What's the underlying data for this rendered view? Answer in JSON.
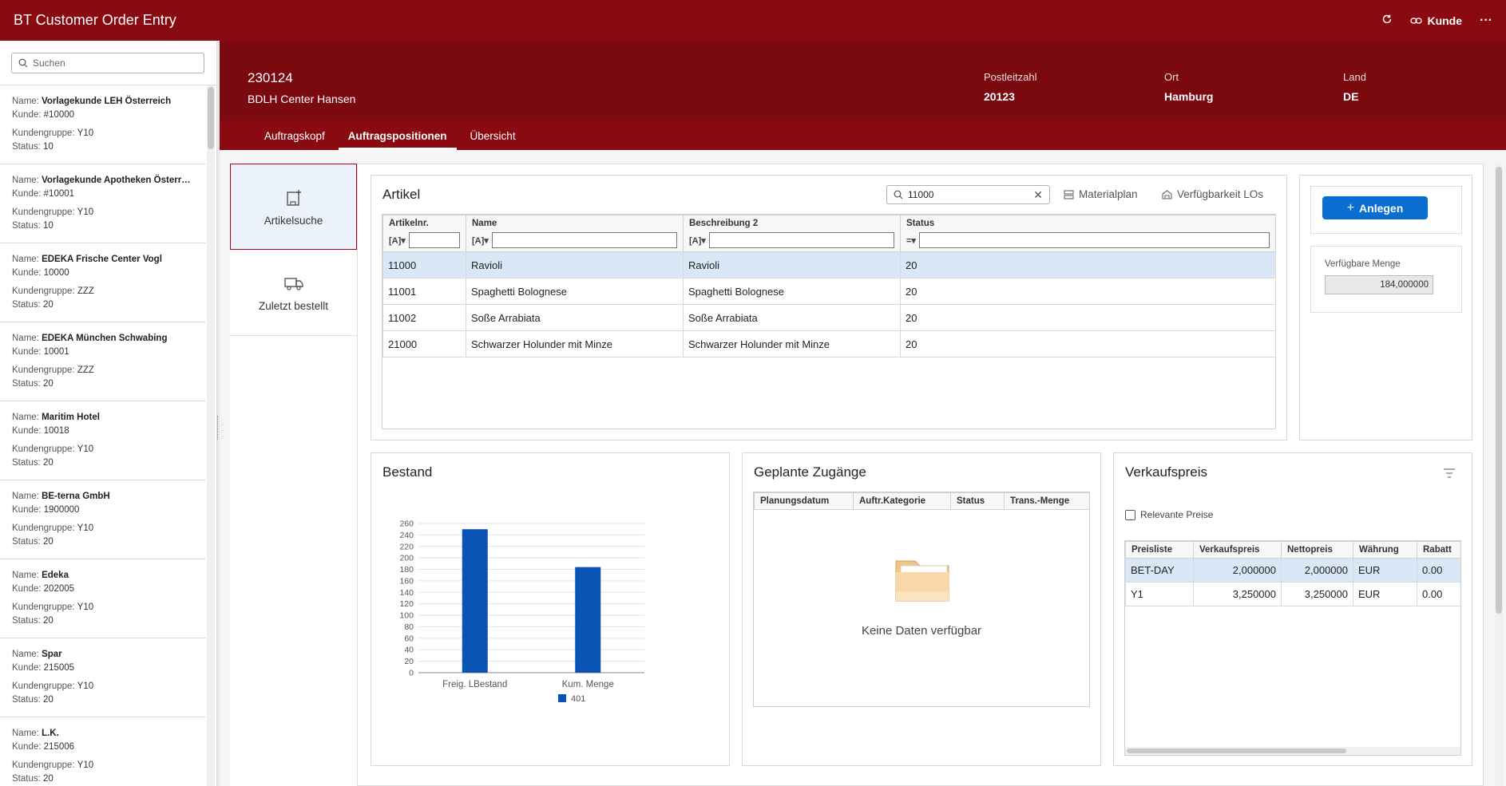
{
  "shell": {
    "title": "BT Customer Order Entry",
    "kunde_label": "Kunde",
    "more": "···"
  },
  "sidebar": {
    "search_placeholder": "Suchen",
    "labels": {
      "name": "Name:",
      "kunde": "Kunde:",
      "gruppe": "Kundengruppe:",
      "status": "Status:"
    },
    "items": [
      {
        "name": "Vorlagekunde LEH Österreich",
        "kunde": "#10000",
        "gruppe": "Y10",
        "status": "10"
      },
      {
        "name": "Vorlagekunde Apotheken Österr…",
        "kunde": "#10001",
        "gruppe": "Y10",
        "status": "10"
      },
      {
        "name": "EDEKA Frische Center Vogl",
        "kunde": "10000",
        "gruppe": "ZZZ",
        "status": "20"
      },
      {
        "name": "EDEKA München Schwabing",
        "kunde": "10001",
        "gruppe": "ZZZ",
        "status": "20"
      },
      {
        "name": "Maritim Hotel",
        "kunde": "10018",
        "gruppe": "Y10",
        "status": "20"
      },
      {
        "name": "BE-terna GmbH",
        "kunde": "1900000",
        "gruppe": "Y10",
        "status": "20"
      },
      {
        "name": "Edeka",
        "kunde": "202005",
        "gruppe": "Y10",
        "status": "20"
      },
      {
        "name": "Spar",
        "kunde": "215005",
        "gruppe": "Y10",
        "status": "20"
      },
      {
        "name": "L.K.",
        "kunde": "215006",
        "gruppe": "Y10",
        "status": "20"
      }
    ]
  },
  "header": {
    "number": "230124",
    "name": "BDLH Center Hansen",
    "postleitzahl_label": "Postleitzahl",
    "postleitzahl": "20123",
    "ort_label": "Ort",
    "ort": "Hamburg",
    "land_label": "Land",
    "land": "DE"
  },
  "tabs": [
    "Auftragskopf",
    "Auftragspositionen",
    "Übersicht"
  ],
  "leftnav": {
    "artikelsuche": "Artikelsuche",
    "zuletzt": "Zuletzt bestellt"
  },
  "artikel": {
    "title": "Artikel",
    "search_value": "11000",
    "materialplan": "Materialplan",
    "verfuegbarkeit": "Verfügbarkeit LOs",
    "columns": [
      "Artikelnr.",
      "Name",
      "Beschreibung 2",
      "Status"
    ],
    "rows": [
      [
        "11000",
        "Ravioli",
        "Ravioli",
        "20"
      ],
      [
        "11001",
        "Spaghetti Bolognese",
        "Spaghetti Bolognese",
        "20"
      ],
      [
        "11002",
        "Soße Arrabiata",
        "Soße Arrabiata",
        "20"
      ],
      [
        "21000",
        "Schwarzer Holunder mit Minze",
        "Schwarzer Holunder mit Minze",
        "20"
      ]
    ]
  },
  "side": {
    "anlegen": "Anlegen",
    "verfuegbare_label": "Verfügbare Menge",
    "verfuegbare_value": "184,000000"
  },
  "bestand": {
    "title": "Bestand"
  },
  "chart_data": {
    "type": "bar",
    "categories": [
      "Freig. LBestand",
      "Kum. Menge"
    ],
    "series": [
      {
        "name": "401",
        "values": [
          250,
          184
        ],
        "color": "#0a52b4"
      }
    ],
    "ylim": [
      0,
      260
    ],
    "yticks": [
      0,
      20,
      40,
      60,
      80,
      100,
      120,
      140,
      160,
      180,
      200,
      220,
      240,
      260
    ],
    "grid": true,
    "legend": "bottom"
  },
  "geplant": {
    "title": "Geplante Zugänge",
    "columns": [
      "Planungsdatum",
      "Auftr.Kategorie",
      "Status",
      "Trans.-Menge"
    ],
    "empty": "Keine Daten verfügbar"
  },
  "vk": {
    "title": "Verkaufspreis",
    "checkbox": "Relevante Preise",
    "columns": [
      "Preisliste",
      "Verkaufspreis",
      "Nettopreis",
      "Währung",
      "Rabatt"
    ],
    "rows": [
      [
        "BET-DAY",
        "2,000000",
        "2,000000",
        "EUR",
        "0.00"
      ],
      [
        "Y1",
        "3,250000",
        "3,250000",
        "EUR",
        "0.00"
      ]
    ]
  }
}
